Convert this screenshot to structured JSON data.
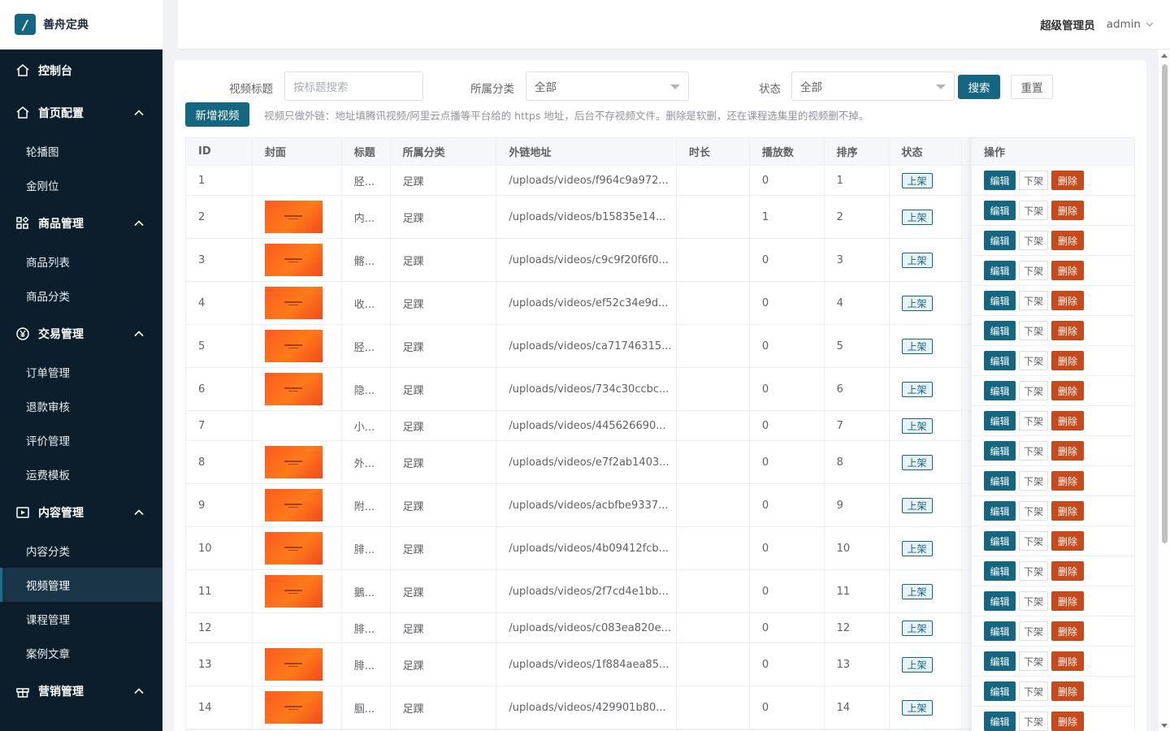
{
  "app": {
    "logo_glyph": "/",
    "name": "善舟定典"
  },
  "header": {
    "role": "超级管理员",
    "username": "admin"
  },
  "sidebar": [
    {
      "type": "group",
      "label": "控制台",
      "icon": "home-icon",
      "chevron": false
    },
    {
      "type": "group",
      "label": "首页配置",
      "icon": "home-icon",
      "chevron": true
    },
    {
      "type": "item",
      "label": "轮播图"
    },
    {
      "type": "item",
      "label": "金刚位"
    },
    {
      "type": "group",
      "label": "商品管理",
      "icon": "grid-icon",
      "chevron": true
    },
    {
      "type": "item",
      "label": "商品列表"
    },
    {
      "type": "item",
      "label": "商品分类"
    },
    {
      "type": "group",
      "label": "交易管理",
      "icon": "yen-icon",
      "chevron": true
    },
    {
      "type": "item",
      "label": "订单管理"
    },
    {
      "type": "item",
      "label": "退款审核"
    },
    {
      "type": "item",
      "label": "评价管理"
    },
    {
      "type": "item",
      "label": "运费模板"
    },
    {
      "type": "group",
      "label": "内容管理",
      "icon": "video-icon",
      "chevron": true
    },
    {
      "type": "item",
      "label": "内容分类"
    },
    {
      "type": "item",
      "label": "视频管理",
      "active": true
    },
    {
      "type": "item",
      "label": "课程管理"
    },
    {
      "type": "item",
      "label": "案例文章"
    },
    {
      "type": "group",
      "label": "营销管理",
      "icon": "gift-icon",
      "chevron": true
    }
  ],
  "filters": {
    "title_label": "视频标题",
    "title_placeholder": "按标题搜索",
    "category_label": "所属分类",
    "category_value": "全部",
    "status_label": "状态",
    "status_value": "全部",
    "search_button": "搜索",
    "reset_button": "重置"
  },
  "toolbar": {
    "add_button": "新增视频",
    "notice": "视频只做外链：地址填腾讯视频/阿里云点播等平台给的 https 地址，后台不存视频文件。删除是软删，还在课程选集里的视频删不掉。"
  },
  "table": {
    "columns": [
      "ID",
      "封面",
      "标题",
      "所属分类",
      "外链地址",
      "时长",
      "播放数",
      "排序",
      "状态",
      "操作"
    ],
    "rows": [
      {
        "id": "1",
        "cover": false,
        "title": "胫...",
        "category": "足踝",
        "url": "/uploads/videos/f964c9a972...",
        "duration": "",
        "plays": "0",
        "sort": "1",
        "status": "上架"
      },
      {
        "id": "2",
        "cover": true,
        "title": "内...",
        "category": "足踝",
        "url": "/uploads/videos/b15835e14...",
        "duration": "",
        "plays": "1",
        "sort": "2",
        "status": "上架"
      },
      {
        "id": "3",
        "cover": true,
        "title": "髂...",
        "category": "足踝",
        "url": "/uploads/videos/c9c9f20f6f0...",
        "duration": "",
        "plays": "0",
        "sort": "3",
        "status": "上架"
      },
      {
        "id": "4",
        "cover": true,
        "title": "收...",
        "category": "足踝",
        "url": "/uploads/videos/ef52c34e9d...",
        "duration": "",
        "plays": "0",
        "sort": "4",
        "status": "上架"
      },
      {
        "id": "5",
        "cover": true,
        "title": "胫...",
        "category": "足踝",
        "url": "/uploads/videos/ca71746315...",
        "duration": "",
        "plays": "0",
        "sort": "5",
        "status": "上架"
      },
      {
        "id": "6",
        "cover": true,
        "title": "隐...",
        "category": "足踝",
        "url": "/uploads/videos/734c30ccbc...",
        "duration": "",
        "plays": "0",
        "sort": "6",
        "status": "上架"
      },
      {
        "id": "7",
        "cover": false,
        "title": "小...",
        "category": "足踝",
        "url": "/uploads/videos/445626690...",
        "duration": "",
        "plays": "0",
        "sort": "7",
        "status": "上架"
      },
      {
        "id": "8",
        "cover": true,
        "title": "外...",
        "category": "足踝",
        "url": "/uploads/videos/e7f2ab1403...",
        "duration": "",
        "plays": "0",
        "sort": "8",
        "status": "上架"
      },
      {
        "id": "9",
        "cover": true,
        "title": "附...",
        "category": "足踝",
        "url": "/uploads/videos/acbfbe9337...",
        "duration": "",
        "plays": "0",
        "sort": "9",
        "status": "上架"
      },
      {
        "id": "10",
        "cover": true,
        "title": "腓...",
        "category": "足踝",
        "url": "/uploads/videos/4b09412fcb...",
        "duration": "",
        "plays": "0",
        "sort": "10",
        "status": "上架"
      },
      {
        "id": "11",
        "cover": true,
        "title": "鵝...",
        "category": "足踝",
        "url": "/uploads/videos/2f7cd4e1bb...",
        "duration": "",
        "plays": "0",
        "sort": "11",
        "status": "上架"
      },
      {
        "id": "12",
        "cover": false,
        "title": "腓...",
        "category": "足踝",
        "url": "/uploads/videos/c083ea820e...",
        "duration": "",
        "plays": "0",
        "sort": "12",
        "status": "上架"
      },
      {
        "id": "13",
        "cover": true,
        "title": "腓...",
        "category": "足踝",
        "url": "/uploads/videos/1f884aea85...",
        "duration": "",
        "plays": "0",
        "sort": "13",
        "status": "上架"
      },
      {
        "id": "14",
        "cover": true,
        "title": "腘...",
        "category": "足踝",
        "url": "/uploads/videos/429901b80...",
        "duration": "",
        "plays": "0",
        "sort": "14",
        "status": "上架"
      }
    ],
    "ops": {
      "edit": "编辑",
      "off": "下架",
      "delete": "删除"
    }
  },
  "colors": {
    "primary": "#156680",
    "danger": "#c74a1c",
    "sidebar_bg": "#0c1e2b"
  }
}
